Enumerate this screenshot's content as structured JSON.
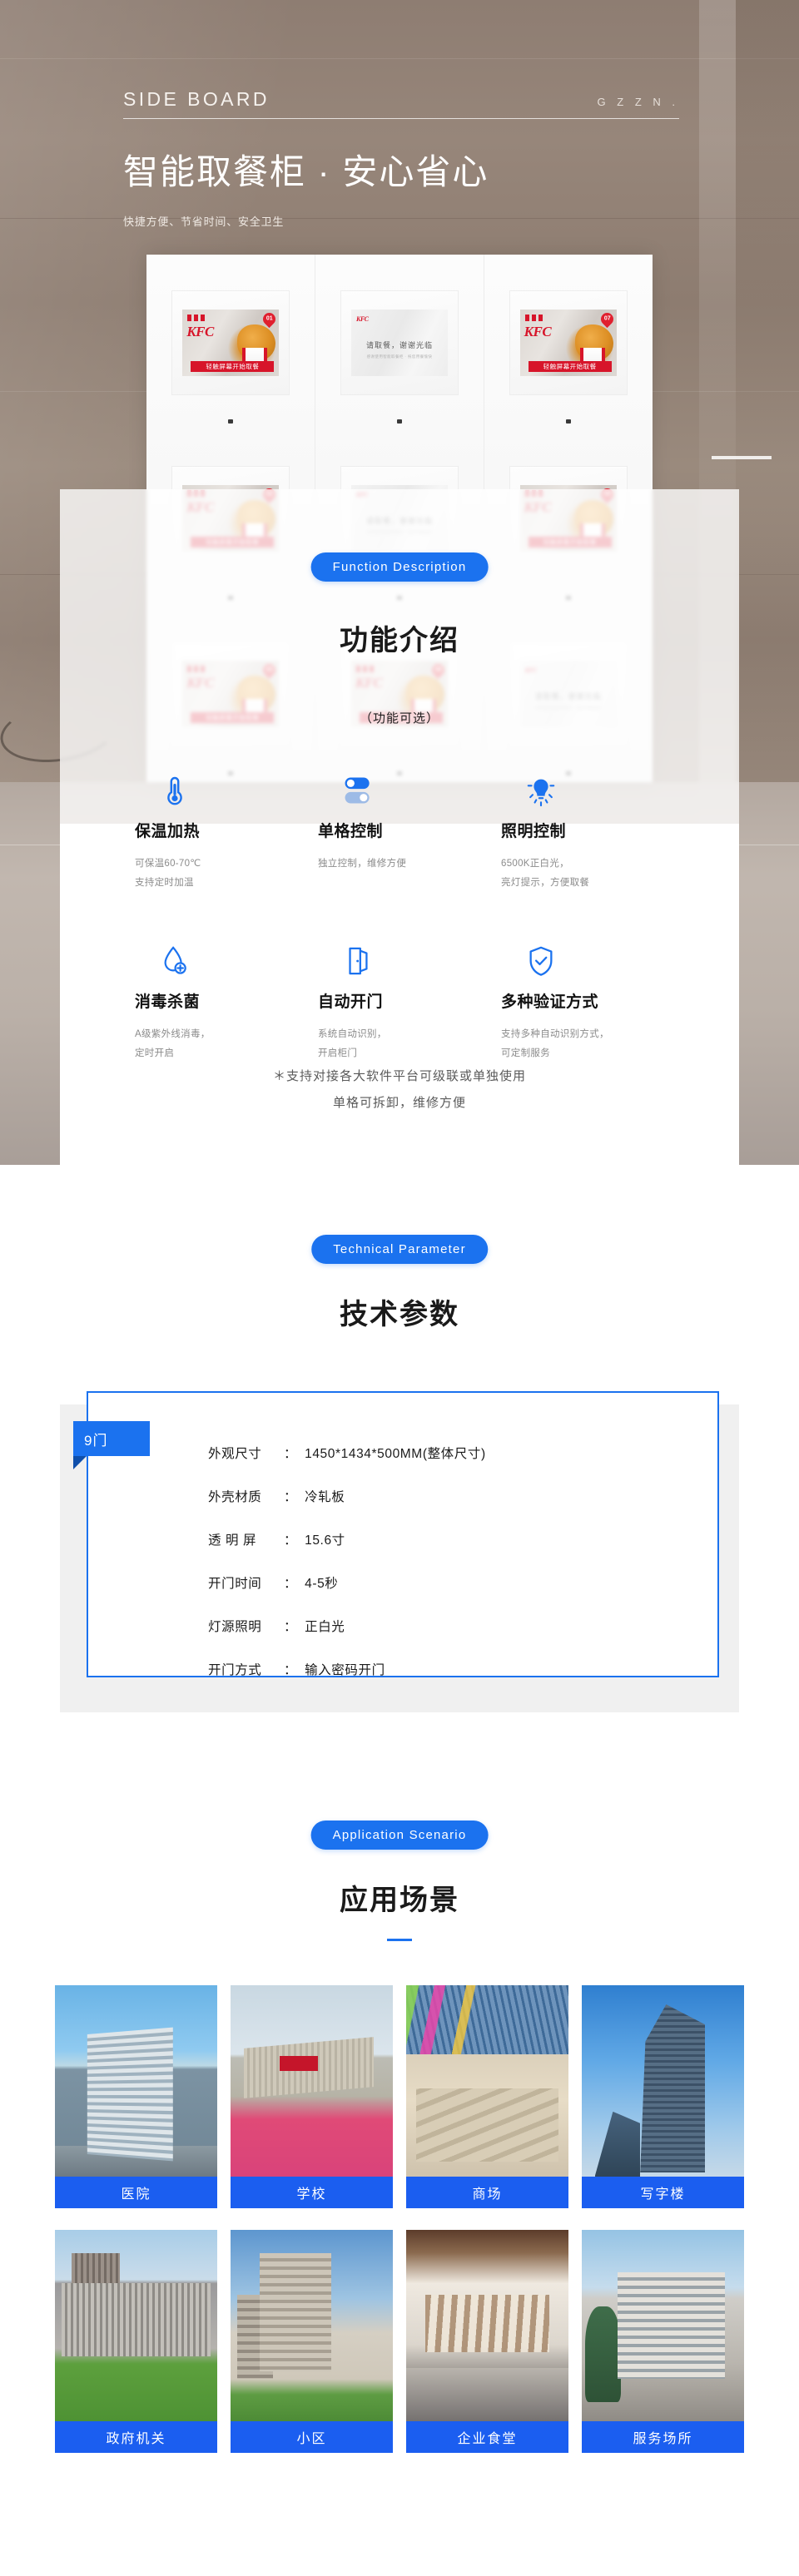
{
  "hero": {
    "brand_en": "SIDE  BOARD",
    "brand_mark": "G Z Z N .",
    "title": "智能取餐柜 · 安心省心",
    "subtitle": "快捷方便、节省时间、安全卫生"
  },
  "product": {
    "cells": [
      {
        "type": "ad",
        "badge": "01",
        "strip": "轻触屏幕开始取餐",
        "logo": "KFC"
      },
      {
        "type": "idle",
        "main": "请取餐，谢谢光临",
        "sub": "感谢使用智能取餐柜 · 祝您用餐愉快",
        "logo": "KFC"
      },
      {
        "type": "ad",
        "badge": "07",
        "strip": "轻触屏幕开始取餐",
        "logo": "KFC"
      },
      {
        "type": "ad",
        "badge": "02",
        "strip": "轻触屏幕开始取餐",
        "logo": "KFC"
      },
      {
        "type": "idle",
        "main": "请取餐，谢谢光临",
        "sub": "感谢使用智能取餐柜 · 祝您用餐愉快",
        "logo": "KFC"
      },
      {
        "type": "ad",
        "badge": "08",
        "strip": "轻触屏幕开始取餐",
        "logo": "KFC"
      },
      {
        "type": "ad",
        "badge": "03",
        "strip": "轻触屏幕开始取餐",
        "logo": "KFC"
      },
      {
        "type": "ad",
        "badge": "06",
        "strip": "轻触屏幕开始取餐",
        "logo": "KFC"
      },
      {
        "type": "idle",
        "main": "请取餐，谢谢光临",
        "sub": "感谢使用智能取餐柜 · 祝您用餐愉快",
        "logo": "KFC"
      }
    ]
  },
  "function_section": {
    "pill": "Function  Description",
    "title_cn": "功能介绍",
    "note": "（功能可选）",
    "features": [
      {
        "icon": "thermometer-icon",
        "name": "保温加热",
        "line1": "可保温60-70℃",
        "line2": "支持定时加温"
      },
      {
        "icon": "toggle-switch-icon",
        "name": "单格控制",
        "line1": "独立控制，维修方便",
        "line2": ""
      },
      {
        "icon": "lightbulb-icon",
        "name": "照明控制",
        "line1": "6500K正白光，",
        "line2": "亮灯提示，方便取餐"
      },
      {
        "icon": "water-drop-plus-icon",
        "name": "消毒杀菌",
        "line1": "A级紫外线消毒，",
        "line2": "定时开启"
      },
      {
        "icon": "open-door-icon",
        "name": "自动开门",
        "line1": "系统自动识别，",
        "line2": "开启柜门"
      },
      {
        "icon": "shield-check-icon",
        "name": "多种验证方式",
        "line1": "支持多种自动识别方式，",
        "line2": "可定制服务"
      }
    ],
    "footnote_line1": "＊支持对接各大软件平台可级联或单独使用",
    "footnote_line2": "单格可拆卸，维修方便"
  },
  "tech_section": {
    "pill": "Technical  Parameter",
    "title_cn": "技术参数",
    "tab_label": "9门",
    "specs": [
      {
        "label": "外观尺寸",
        "value": "1450*1434*500MM(整体尺寸)"
      },
      {
        "label": "外壳材质",
        "value": "冷轧板"
      },
      {
        "label": "透 明 屏",
        "value": "15.6寸"
      },
      {
        "label": "开门时间",
        "value": "4-5秒"
      },
      {
        "label": "灯源照明",
        "value": "正白光"
      },
      {
        "label": "开门方式",
        "value": " 输入密码开门"
      }
    ]
  },
  "scenario_section": {
    "pill": "Application  Scenario",
    "title_cn": "应用场景",
    "cards": [
      {
        "caption": "医院",
        "photo": "ph-hospital"
      },
      {
        "caption": "学校",
        "photo": "ph-school"
      },
      {
        "caption": "商场",
        "photo": "ph-mall"
      },
      {
        "caption": "写字楼",
        "photo": "ph-tower"
      },
      {
        "caption": "政府机关",
        "photo": "ph-gov"
      },
      {
        "caption": "小区",
        "photo": "ph-comm"
      },
      {
        "caption": "企业食堂",
        "photo": "ph-canteen"
      },
      {
        "caption": "服务场所",
        "photo": "ph-service"
      }
    ]
  },
  "colors": {
    "accent_blue": "#1b72ef",
    "scenario_blue": "#1b5ef0",
    "kfc_red": "#d7152a"
  }
}
